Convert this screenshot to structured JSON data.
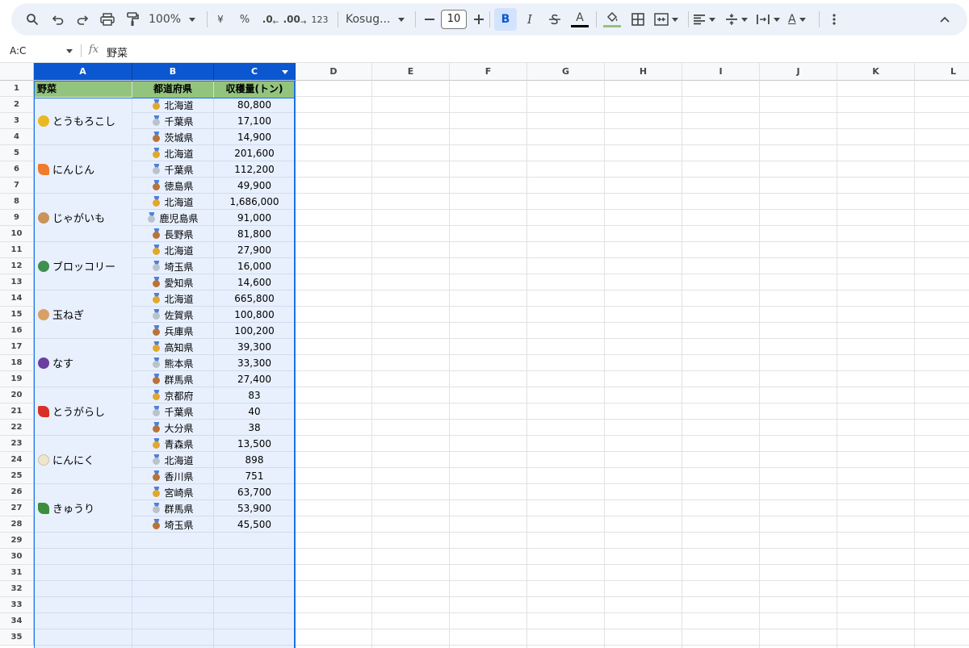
{
  "toolbar": {
    "zoom": "100%",
    "currency": "¥",
    "percent": "%",
    "decrease_decimal": ".0",
    "increase_decimal": ".00",
    "number_format": "123",
    "font": "Kosug...",
    "font_size": "10",
    "bold": "B",
    "italic": "I",
    "text_color_letter": "A",
    "text_color": "#000000",
    "fill_color": "#93c47d"
  },
  "formula_bar": {
    "name_box": "A:C",
    "fx": "fx",
    "content": "野菜"
  },
  "columns": [
    "A",
    "B",
    "C",
    "D",
    "E",
    "F",
    "G",
    "H",
    "I",
    "J",
    "K",
    "L"
  ],
  "rows": [
    "1",
    "2",
    "3",
    "4",
    "5",
    "6",
    "7",
    "8",
    "9",
    "10",
    "11",
    "12",
    "13",
    "14",
    "15",
    "16",
    "17",
    "18",
    "19",
    "20",
    "21",
    "22",
    "23",
    "24",
    "25",
    "26",
    "27",
    "28",
    "29",
    "30",
    "31",
    "32",
    "33",
    "34",
    "35"
  ],
  "header": {
    "vegetable": "野菜",
    "prefecture": "都道府県",
    "harvest": "収穫量(トン)",
    "fill": "#93c47d"
  },
  "medal_colors": {
    "gold": "#e0a82e",
    "silver": "#b9c3cc",
    "bronze": "#b8733a"
  },
  "groups": [
    {
      "vegetable": "とうもろこし",
      "icon": "corn-icon",
      "icon_color": "#e8b923",
      "entries": [
        {
          "pref": "北海道",
          "value": "80,800"
        },
        {
          "pref": "千葉県",
          "value": "17,100"
        },
        {
          "pref": "茨城県",
          "value": "14,900"
        }
      ]
    },
    {
      "vegetable": "にんじん",
      "icon": "carrot-icon",
      "icon_color": "#f07b2a",
      "entries": [
        {
          "pref": "北海道",
          "value": "201,600"
        },
        {
          "pref": "千葉県",
          "value": "112,200"
        },
        {
          "pref": "徳島県",
          "value": "49,900"
        }
      ]
    },
    {
      "vegetable": "じゃがいも",
      "icon": "potato-icon",
      "icon_color": "#c9935a",
      "entries": [
        {
          "pref": "北海道",
          "value": "1,686,000"
        },
        {
          "pref": "鹿児島県",
          "value": "91,000"
        },
        {
          "pref": "長野県",
          "value": "81,800"
        }
      ]
    },
    {
      "vegetable": "ブロッコリー",
      "icon": "broccoli-icon",
      "icon_color": "#3f8f4f",
      "entries": [
        {
          "pref": "北海道",
          "value": "27,900"
        },
        {
          "pref": "埼玉県",
          "value": "16,000"
        },
        {
          "pref": "愛知県",
          "value": "14,600"
        }
      ]
    },
    {
      "vegetable": "玉ねぎ",
      "icon": "onion-icon",
      "icon_color": "#d9a066",
      "entries": [
        {
          "pref": "北海道",
          "value": "665,800"
        },
        {
          "pref": "佐賀県",
          "value": "100,800"
        },
        {
          "pref": "兵庫県",
          "value": "100,200"
        }
      ]
    },
    {
      "vegetable": "なす",
      "icon": "eggplant-icon",
      "icon_color": "#6b3fa0",
      "entries": [
        {
          "pref": "高知県",
          "value": "39,300"
        },
        {
          "pref": "熊本県",
          "value": "33,300"
        },
        {
          "pref": "群馬県",
          "value": "27,400"
        }
      ]
    },
    {
      "vegetable": "とうがらし",
      "icon": "chili-icon",
      "icon_color": "#d93025",
      "entries": [
        {
          "pref": "京都府",
          "value": "83"
        },
        {
          "pref": "千葉県",
          "value": "40"
        },
        {
          "pref": "大分県",
          "value": "38"
        }
      ]
    },
    {
      "vegetable": "にんにく",
      "icon": "garlic-icon",
      "icon_color": "#efe6cf",
      "entries": [
        {
          "pref": "青森県",
          "value": "13,500"
        },
        {
          "pref": "北海道",
          "value": "898"
        },
        {
          "pref": "香川県",
          "value": "751"
        }
      ]
    },
    {
      "vegetable": "きゅうり",
      "icon": "cucumber-icon",
      "icon_color": "#3c8d3c",
      "entries": [
        {
          "pref": "宮崎県",
          "value": "63,700"
        },
        {
          "pref": "群馬県",
          "value": "53,900"
        },
        {
          "pref": "埼玉県",
          "value": "45,500"
        }
      ]
    }
  ]
}
